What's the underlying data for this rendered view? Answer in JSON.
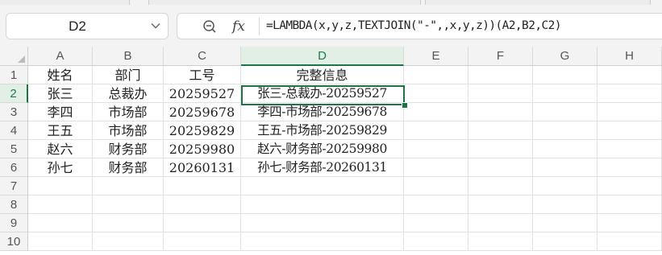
{
  "name_box": {
    "value": "D2"
  },
  "formula_bar": {
    "fx_label": "fx",
    "formula": "=LAMBDA(x,y,z,TEXTJOIN(\"-\",,x,y,z))(A2,B2,C2)"
  },
  "columns": [
    "A",
    "B",
    "C",
    "D",
    "E",
    "F",
    "G",
    "H"
  ],
  "rows": [
    "1",
    "2",
    "3",
    "4",
    "5",
    "6",
    "7",
    "8",
    "9",
    "10"
  ],
  "sheet": {
    "headers": [
      "姓名",
      "部门",
      "工号",
      "完整信息"
    ],
    "data": [
      [
        "张三",
        "总裁办",
        "20259527",
        "张三-总裁办-20259527"
      ],
      [
        "李四",
        "市场部",
        "20259678",
        "李四-市场部-20259678"
      ],
      [
        "王五",
        "市场部",
        "20259829",
        "王五-市场部-20259829"
      ],
      [
        "赵六",
        "财务部",
        "20259980",
        "赵六-财务部-20259980"
      ],
      [
        "孙七",
        "财务部",
        "20260131",
        "孙七-财务部-20260131"
      ]
    ]
  },
  "selection": {
    "cell": "D2",
    "column": "D",
    "row": "2"
  },
  "colors": {
    "accent": "#217346",
    "header_bg": "#f3f3f3",
    "selected_header_bg": "#e2efe7"
  },
  "icons": {
    "name_box_dropdown": "chevron-down-icon",
    "formula_zoom": "zoom-out-icon"
  }
}
